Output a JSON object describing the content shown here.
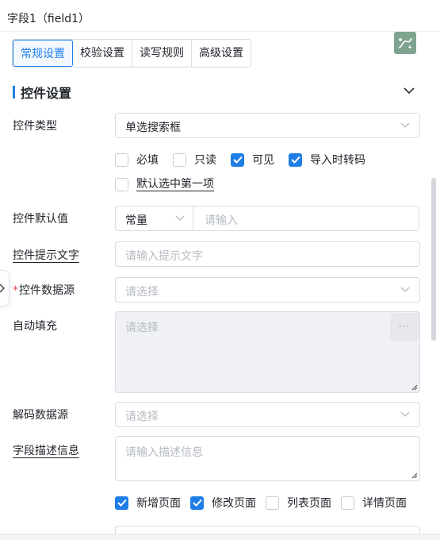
{
  "header": {
    "title": "字段1（field1）"
  },
  "tabs": [
    {
      "label": "常规设置",
      "active": true
    },
    {
      "label": "校验设置",
      "active": false
    },
    {
      "label": "读写规则",
      "active": false
    },
    {
      "label": "高级设置",
      "active": false
    }
  ],
  "section": {
    "title": "控件设置"
  },
  "form": {
    "control_type": {
      "label": "控件类型",
      "value": "单选搜索框"
    },
    "flags_row1": [
      {
        "label": "必填",
        "checked": false
      },
      {
        "label": "只读",
        "checked": false
      },
      {
        "label": "可见",
        "checked": true
      },
      {
        "label": "导入时转码",
        "checked": true
      }
    ],
    "flag_default_first": {
      "label": "默认选中第一项",
      "checked": false
    },
    "default_value": {
      "label": "控件默认值",
      "mode": "常量",
      "placeholder": "请输入"
    },
    "hint_text": {
      "label": "控件提示文字",
      "placeholder": "请输入提示文字"
    },
    "data_source": {
      "label": "控件数据源",
      "required_mark": "*",
      "placeholder": "请选择"
    },
    "autofill": {
      "label": "自动填充",
      "placeholder": "请选择",
      "button": "···"
    },
    "decode_source": {
      "label": "解码数据源",
      "placeholder": "请选择"
    },
    "description": {
      "label": "字段描述信息",
      "placeholder": "请输入描述信息"
    },
    "pages": [
      {
        "label": "新增页面",
        "checked": true
      },
      {
        "label": "修改页面",
        "checked": true
      },
      {
        "label": "列表页面",
        "checked": false
      },
      {
        "label": "详情页面",
        "checked": false
      }
    ]
  },
  "colors": {
    "accent": "#1f7ee6",
    "required": "#e34d59",
    "border": "#d7dbe2",
    "placeholder": "#b5bac2"
  }
}
